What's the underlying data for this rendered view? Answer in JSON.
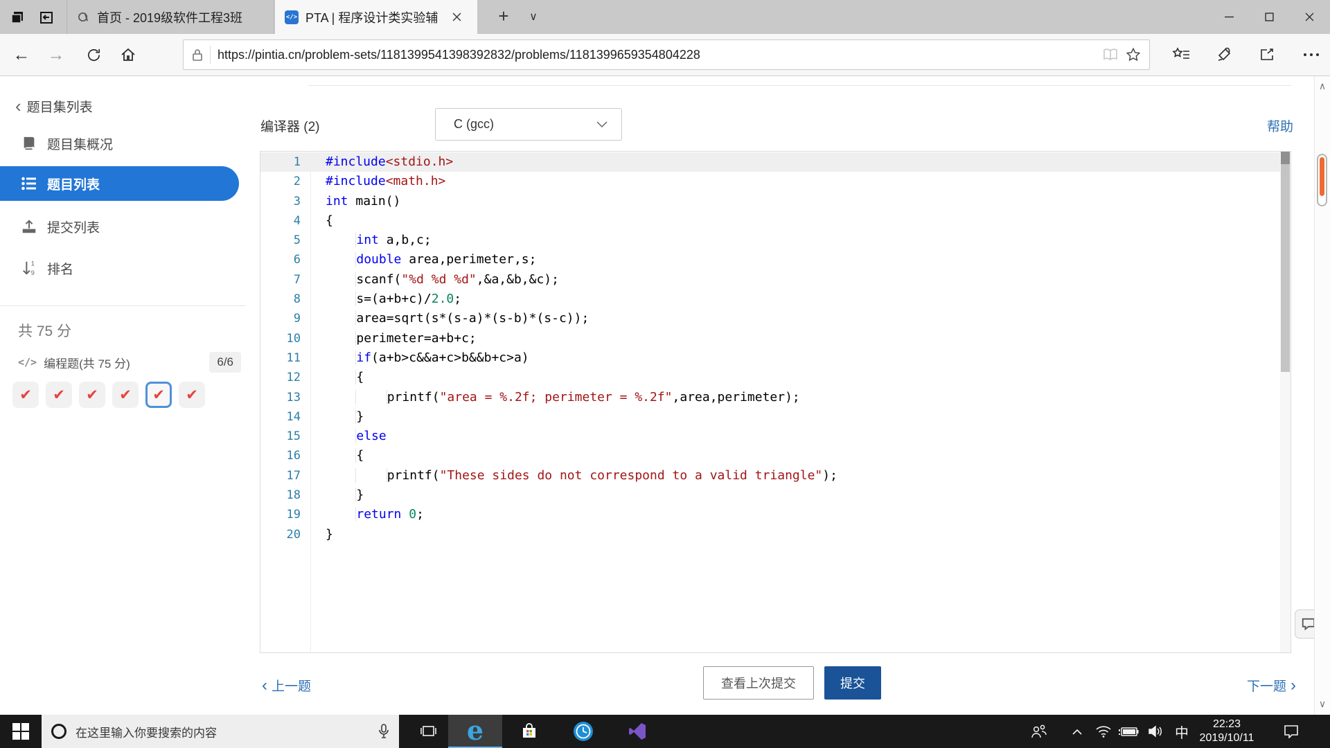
{
  "colors": {
    "accent_blue": "#2176d6",
    "submit_blue": "#1a5398",
    "link_blue": "#2d70b3",
    "check_red": "#e5433e",
    "code_keyword": "#0000f0",
    "code_string": "#a31515",
    "code_number": "#098658",
    "line_number": "#2b7ea8",
    "scroll_marker_orange": "#ef6a31"
  },
  "browser": {
    "tabs": [
      {
        "title": "首页 - 2019级软件工程3班 -",
        "active": false
      },
      {
        "title": "PTA | 程序设计类实验辅",
        "active": true
      }
    ],
    "url": "https://pintia.cn/problem-sets/1181399541398392832/problems/1181399659354804228"
  },
  "sidebar": {
    "back_label": "题目集列表",
    "items": [
      {
        "label": "题目集概况",
        "icon": "book-icon",
        "active": false
      },
      {
        "label": "题目列表",
        "icon": "list-icon",
        "active": true
      },
      {
        "label": "提交列表",
        "icon": "upload-icon",
        "active": false
      },
      {
        "label": "排名",
        "icon": "rank-icon",
        "active": false
      }
    ],
    "total_score": "共 75 分",
    "section_label": "编程题(共 75 分)",
    "section_progress": "6/6",
    "problems": [
      {
        "solved": true,
        "current": false
      },
      {
        "solved": true,
        "current": false
      },
      {
        "solved": true,
        "current": false
      },
      {
        "solved": true,
        "current": false
      },
      {
        "solved": true,
        "current": true
      },
      {
        "solved": true,
        "current": false
      }
    ]
  },
  "main": {
    "compiler_label": "编译器 (2)",
    "compiler_value": "C (gcc)",
    "help_label": "帮助",
    "code": {
      "language": "C",
      "lines": [
        [
          {
            "c": "kw",
            "t": "#include"
          },
          {
            "c": "str",
            "t": "<stdio.h>"
          }
        ],
        [
          {
            "c": "kw",
            "t": "#include"
          },
          {
            "c": "str",
            "t": "<math.h>"
          }
        ],
        [
          {
            "c": "kw",
            "t": "int"
          },
          {
            "c": "pl",
            "t": " main()"
          }
        ],
        [
          {
            "c": "pl",
            "t": "{"
          }
        ],
        [
          {
            "c": "pl",
            "t": "    "
          },
          {
            "c": "kw",
            "t": "int"
          },
          {
            "c": "pl",
            "t": " a,b,c;"
          }
        ],
        [
          {
            "c": "pl",
            "t": "    "
          },
          {
            "c": "kw",
            "t": "double"
          },
          {
            "c": "pl",
            "t": " area,perimeter,s;"
          }
        ],
        [
          {
            "c": "pl",
            "t": "    scanf("
          },
          {
            "c": "str",
            "t": "\"%d %d %d\""
          },
          {
            "c": "pl",
            "t": ",&a,&b,&c);"
          }
        ],
        [
          {
            "c": "pl",
            "t": "    s=(a+b+c)/"
          },
          {
            "c": "num",
            "t": "2.0"
          },
          {
            "c": "pl",
            "t": ";"
          }
        ],
        [
          {
            "c": "pl",
            "t": "    area=sqrt(s*(s-a)*(s-b)*(s-c));"
          }
        ],
        [
          {
            "c": "pl",
            "t": "    perimeter=a+b+c;"
          }
        ],
        [
          {
            "c": "pl",
            "t": "    "
          },
          {
            "c": "kw",
            "t": "if"
          },
          {
            "c": "pl",
            "t": "(a+b>c&&a+c>b&&b+c>a)"
          }
        ],
        [
          {
            "c": "pl",
            "t": "    {"
          }
        ],
        [
          {
            "c": "pl",
            "t": "        printf("
          },
          {
            "c": "str",
            "t": "\"area = %.2f; perimeter = %.2f\""
          },
          {
            "c": "pl",
            "t": ",area,perimeter);"
          }
        ],
        [
          {
            "c": "pl",
            "t": "    }"
          }
        ],
        [
          {
            "c": "pl",
            "t": "    "
          },
          {
            "c": "kw",
            "t": "else"
          }
        ],
        [
          {
            "c": "pl",
            "t": "    {"
          }
        ],
        [
          {
            "c": "pl",
            "t": "        printf("
          },
          {
            "c": "str",
            "t": "\"These sides do not correspond to a valid triangle\""
          },
          {
            "c": "pl",
            "t": ");"
          }
        ],
        [
          {
            "c": "pl",
            "t": "    }"
          }
        ],
        [
          {
            "c": "pl",
            "t": "    "
          },
          {
            "c": "kw",
            "t": "return"
          },
          {
            "c": "pl",
            "t": " "
          },
          {
            "c": "num",
            "t": "0"
          },
          {
            "c": "pl",
            "t": ";"
          }
        ],
        [
          {
            "c": "pl",
            "t": "}"
          }
        ]
      ]
    },
    "nav": {
      "prev": "上一题",
      "view_last": "查看上次提交",
      "submit": "提交",
      "next": "下一题"
    }
  },
  "taskbar": {
    "search_placeholder": "在这里输入你要搜索的内容",
    "ime_indicator": "中",
    "time": "22:23",
    "date": "2019/10/11"
  }
}
